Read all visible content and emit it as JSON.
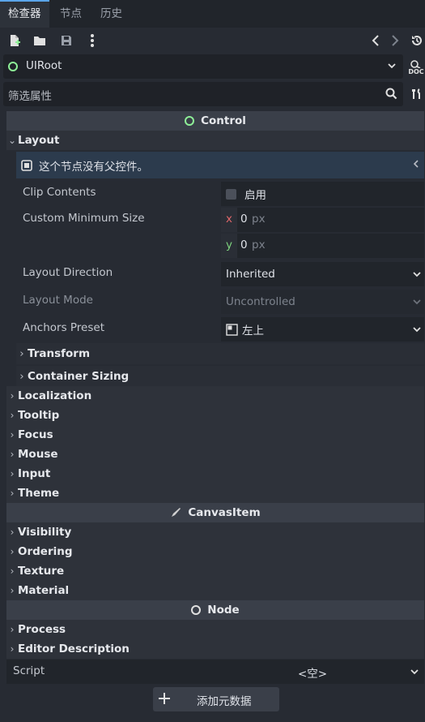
{
  "tabs": [
    {
      "label": "检查器",
      "active": true
    },
    {
      "label": "节点",
      "active": false
    },
    {
      "label": "历史",
      "active": false
    }
  ],
  "node_selector": {
    "name": "UIRoot"
  },
  "filter": {
    "placeholder": "筛选属性"
  },
  "sections": {
    "control": "Control",
    "canvas_item": "CanvasItem",
    "node": "Node"
  },
  "layout": {
    "group_label": "Layout",
    "warning": "这个节点没有父控件。",
    "clip_contents": {
      "label": "Clip Contents",
      "checkbox_label": "启用",
      "checked": false
    },
    "custom_min_size": {
      "label": "Custom Minimum Size",
      "x_label": "x",
      "x_value": "0",
      "y_label": "y",
      "y_value": "0",
      "unit": "px"
    },
    "layout_direction": {
      "label": "Layout Direction",
      "value": "Inherited"
    },
    "layout_mode": {
      "label": "Layout Mode",
      "value": "Uncontrolled"
    },
    "anchors_preset": {
      "label": "Anchors Preset",
      "value": "左上"
    },
    "subgroups": [
      "Transform",
      "Container Sizing"
    ]
  },
  "control_groups": [
    "Localization",
    "Tooltip",
    "Focus",
    "Mouse",
    "Input",
    "Theme"
  ],
  "canvas_groups": [
    "Visibility",
    "Ordering",
    "Texture",
    "Material"
  ],
  "node_groups": [
    "Process",
    "Editor Description"
  ],
  "script": {
    "label": "Script",
    "value": "<空>"
  },
  "add_metadata": {
    "label": "添加元数据"
  },
  "colors": {
    "accent": "#5aa5ea",
    "control_green": "#8eef97",
    "x_red": "#e0676a",
    "y_green": "#7ed37e"
  }
}
